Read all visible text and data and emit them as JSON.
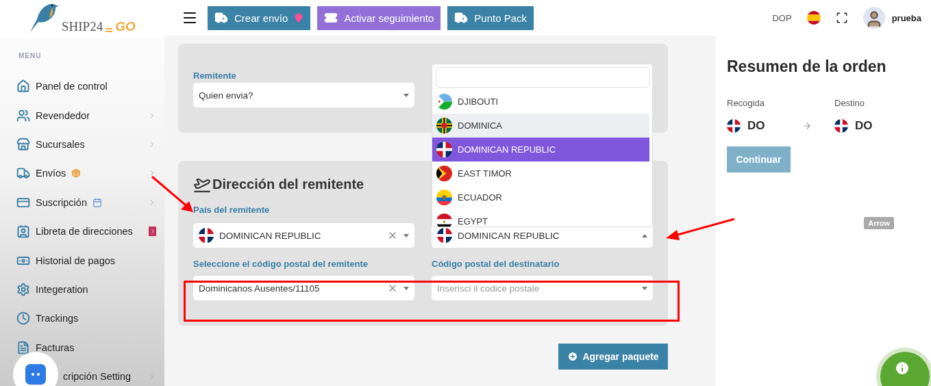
{
  "logo": {
    "text": "SHIP24",
    "accent": "GO"
  },
  "header": {
    "actions": [
      {
        "label": "Crear envío",
        "color": "#3a82a6"
      },
      {
        "label": "Activar seguimiento",
        "color": "#9270d8"
      },
      {
        "label": "Punto Pack",
        "color": "#3a82a6"
      }
    ],
    "currency": "DOP",
    "user": "prueba"
  },
  "sidebar": {
    "heading": "MENU",
    "items": [
      {
        "label": "Panel de control",
        "expandable": false
      },
      {
        "label": "Revendedor",
        "expandable": true
      },
      {
        "label": "Sucursales",
        "expandable": true
      },
      {
        "label": "Envíos",
        "expandable": true
      },
      {
        "label": "Suscripción",
        "expandable": true
      },
      {
        "label": "Libreta de direcciones",
        "expandable": true
      },
      {
        "label": "Historial de pagos",
        "expandable": false
      },
      {
        "label": "Integeration",
        "expandable": false
      },
      {
        "label": "Trackings",
        "expandable": false
      },
      {
        "label": "Facturas",
        "expandable": false
      },
      {
        "label": "cripción Setting",
        "expandable": true
      }
    ]
  },
  "sender": {
    "label": "Remitente",
    "placeholder": "Quien envia?"
  },
  "address": {
    "title": "Dirección del remitente",
    "fields": [
      {
        "label": "País del remitente",
        "value": "DOMINICAN REPUBLIC",
        "clearable": true,
        "open": false
      },
      {
        "value": "DOMINICAN REPUBLIC",
        "clearable": false,
        "open": true
      },
      {
        "label": "Seleccione el código postal del remitente",
        "value": "Dominicanos Ausentes/11105",
        "clearable": true,
        "open": false
      },
      {
        "label": "Código postal del destinatario",
        "placeholder": "Inserisci il codice postale",
        "clearable": false,
        "open": false
      }
    ]
  },
  "dropdown": {
    "options": [
      {
        "label": "DJIBOUTI",
        "hovered": false,
        "selected": false
      },
      {
        "label": "DOMINICA",
        "hovered": true,
        "selected": false
      },
      {
        "label": "DOMINICAN REPUBLIC",
        "hovered": false,
        "selected": true
      },
      {
        "label": "EAST TIMOR",
        "hovered": false,
        "selected": false
      },
      {
        "label": "ECUADOR",
        "hovered": false,
        "selected": false
      },
      {
        "label": "EGYPT",
        "hovered": false,
        "selected": false
      }
    ]
  },
  "add_package": {
    "label": "Agregar paquete"
  },
  "summary": {
    "title": "Resumen de la orden",
    "pickup": {
      "label": "Recogida",
      "code": "DO"
    },
    "destination": {
      "label": "Destino",
      "code": "DO"
    },
    "continue": {
      "label": "Continuar",
      "disabled": true
    },
    "tag": "Arrow"
  },
  "annotations": [
    {
      "kind": "arrow"
    },
    {
      "kind": "arrow"
    },
    {
      "kind": "box"
    }
  ]
}
